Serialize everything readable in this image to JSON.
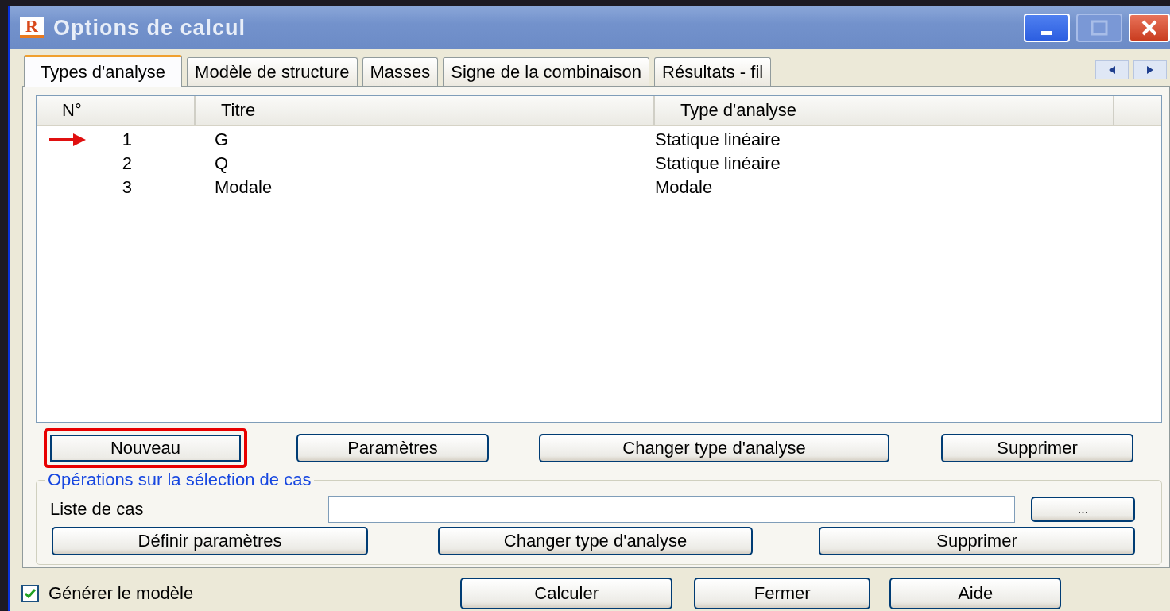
{
  "window": {
    "logo": "R",
    "title": "Options de calcul",
    "maximize_disabled": true
  },
  "tabs": [
    {
      "label": "Types d'analyse",
      "selected": true
    },
    {
      "label": "Modèle de structure",
      "selected": false
    },
    {
      "label": "Masses",
      "selected": false
    },
    {
      "label": "Signe de la combinaison",
      "selected": false
    },
    {
      "label": "Résultats - fil",
      "selected": false
    }
  ],
  "table": {
    "columns": [
      "N°",
      "Titre",
      "Type d'analyse"
    ],
    "rows": [
      {
        "number": "1",
        "title": "G",
        "type": "Statique linéaire",
        "current": true
      },
      {
        "number": "2",
        "title": "Q",
        "type": "Statique linéaire",
        "current": false
      },
      {
        "number": "3",
        "title": "Modale",
        "type": "Modale",
        "current": false
      }
    ]
  },
  "buttons": [
    {
      "label": "Nouveau",
      "focused": true
    },
    {
      "label": "Paramètres",
      "focused": false
    },
    {
      "label": "Changer type d'analyse",
      "focused": false
    },
    {
      "label": "Supprimer",
      "focused": false
    }
  ],
  "selection_group": {
    "title": "Opérations sur la sélection de cas",
    "case_list_label": "Liste de cas",
    "browse_button": "...",
    "buttons": [
      "Définir paramètres",
      "Changer type d'analyse",
      "Supprimer"
    ]
  },
  "generate_model": {
    "label": "Générer le modèle",
    "checked": true
  },
  "footer_buttons": [
    "Calculer",
    "Fermer",
    "Aide"
  ]
}
